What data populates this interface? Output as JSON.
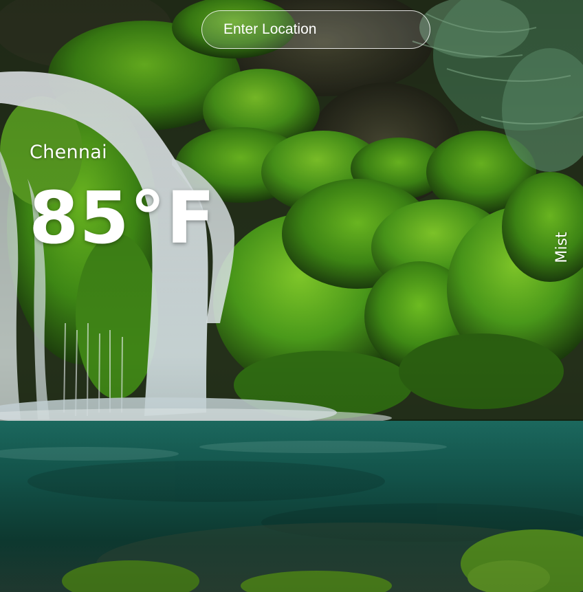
{
  "search": {
    "placeholder": "Enter Location"
  },
  "weather": {
    "city": "Chennai",
    "temperature": "85°F",
    "condition": "Mist"
  },
  "background": {
    "scene": "mossy waterfall and pool"
  }
}
